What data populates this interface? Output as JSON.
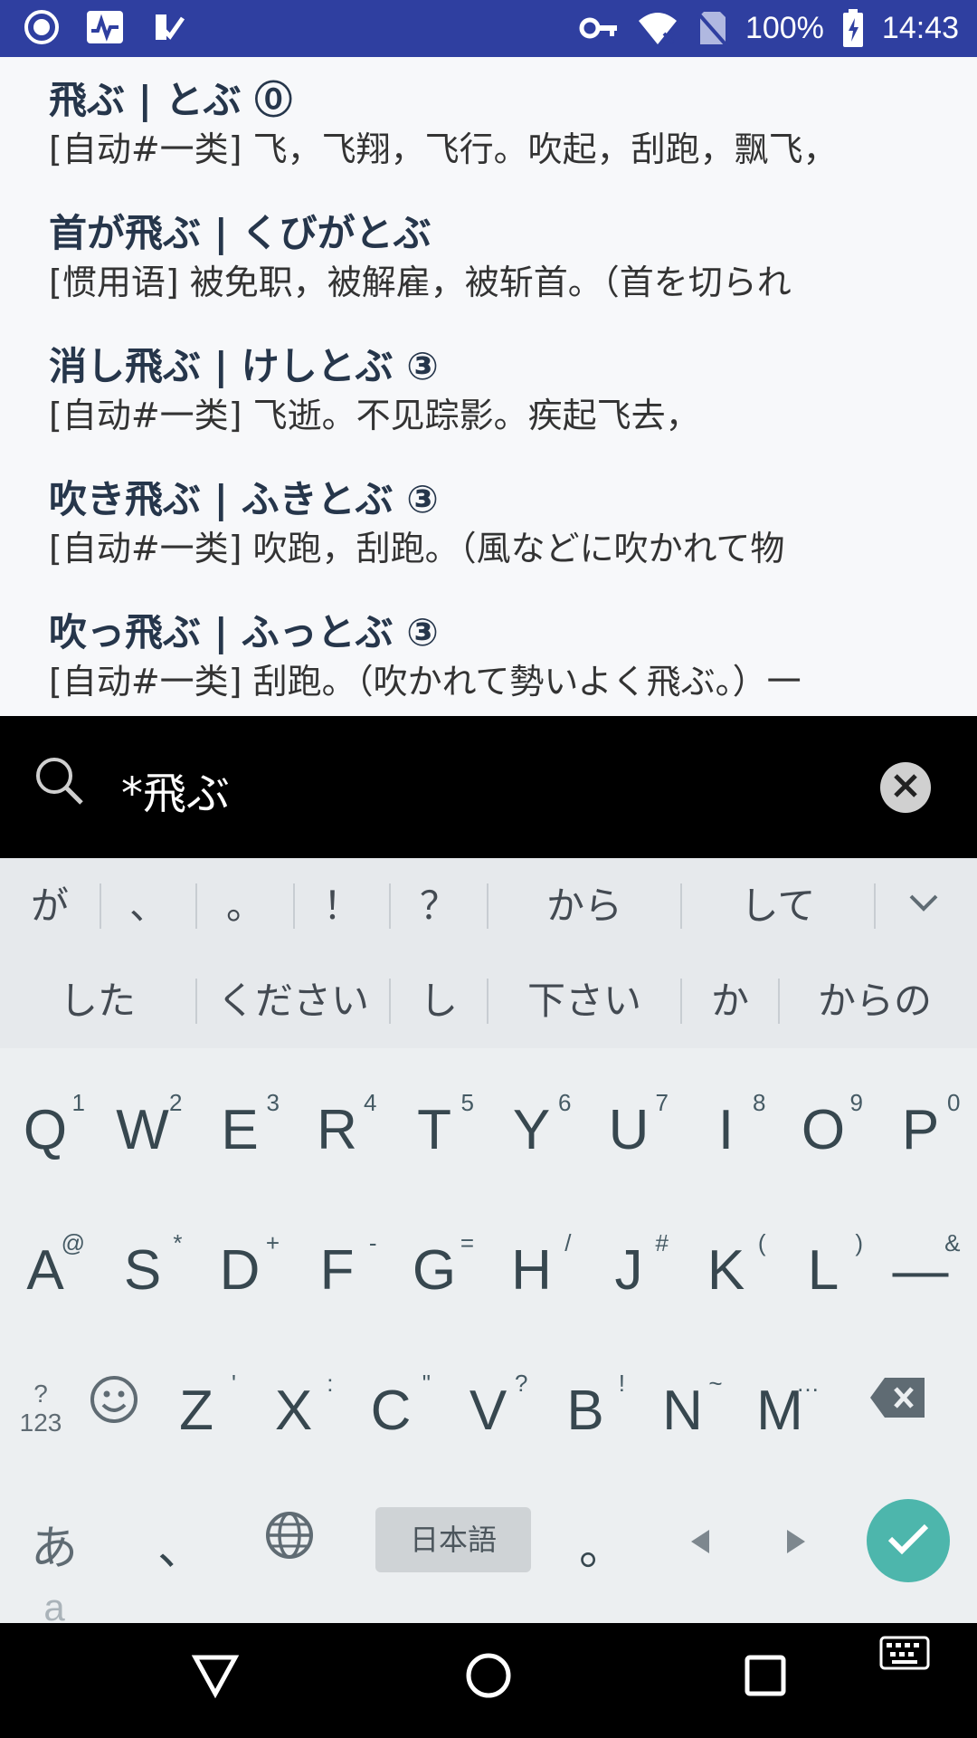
{
  "statusbar": {
    "battery": "100%",
    "time": "14:43",
    "icons": [
      "app-icon",
      "activity-icon",
      "check-icon",
      "key-icon",
      "wifi-icon",
      "no-sim-icon",
      "battery-charging-icon"
    ]
  },
  "results": [
    {
      "headword": "飛ぶ | とぶ ⓪",
      "gloss": "[自动#一类] 飞，飞翔，飞行。吹起，刮跑，飘飞，"
    },
    {
      "headword": "首が飛ぶ | くびがとぶ",
      "gloss": "[惯用语] 被免职，被解雇，被斩首。（首を切られ"
    },
    {
      "headword": "消し飛ぶ | けしとぶ ③",
      "gloss": "[自动#一类] 飞逝。不见踪影。疾起飞去，"
    },
    {
      "headword": "吹き飛ぶ | ふきとぶ ③",
      "gloss": "[自动#一类] 吹跑，刮跑。（風などに吹かれて物"
    },
    {
      "headword": "吹っ飛ぶ | ふっとぶ ③",
      "gloss": "[自动#一类] 刮跑。（吹かれて勢いよく飛ぶ。）一"
    }
  ],
  "search": {
    "value": "*飛ぶ"
  },
  "suggestions": {
    "row1": [
      "が",
      "、",
      "。",
      "！",
      "？",
      "から",
      "して"
    ],
    "row2": [
      "した",
      "ください",
      "し",
      "下さい",
      "か",
      "からの"
    ]
  },
  "keyboard": {
    "row1": [
      {
        "key": "Q",
        "hint": "1"
      },
      {
        "key": "W",
        "hint": "2"
      },
      {
        "key": "E",
        "hint": "3"
      },
      {
        "key": "R",
        "hint": "4"
      },
      {
        "key": "T",
        "hint": "5"
      },
      {
        "key": "Y",
        "hint": "6"
      },
      {
        "key": "U",
        "hint": "7"
      },
      {
        "key": "I",
        "hint": "8"
      },
      {
        "key": "O",
        "hint": "9"
      },
      {
        "key": "P",
        "hint": "0"
      }
    ],
    "row2": [
      {
        "key": "A",
        "hint": "@"
      },
      {
        "key": "S",
        "hint": "*"
      },
      {
        "key": "D",
        "hint": "+"
      },
      {
        "key": "F",
        "hint": "-"
      },
      {
        "key": "G",
        "hint": "="
      },
      {
        "key": "H",
        "hint": "/"
      },
      {
        "key": "J",
        "hint": "#"
      },
      {
        "key": "K",
        "hint": "("
      },
      {
        "key": "L",
        "hint": ")"
      },
      {
        "key": "—",
        "hint": "&"
      }
    ],
    "row3": [
      {
        "key": "Z",
        "hint": "'"
      },
      {
        "key": "X",
        "hint": ":"
      },
      {
        "key": "C",
        "hint": "\""
      },
      {
        "key": "V",
        "hint": "?"
      },
      {
        "key": "B",
        "hint": "!"
      },
      {
        "key": "N",
        "hint": "~"
      },
      {
        "key": "M",
        "hint": "…"
      }
    ],
    "symbols_label": "?123",
    "kana_label": "あ",
    "kana_small_label": "a",
    "comma": "、",
    "period": "。",
    "language_label": "日本語"
  },
  "colors": {
    "statusbar": "#2f3fa0",
    "headword": "#26364b",
    "enter_key": "#4db6ac",
    "caret": "#e05a83"
  }
}
